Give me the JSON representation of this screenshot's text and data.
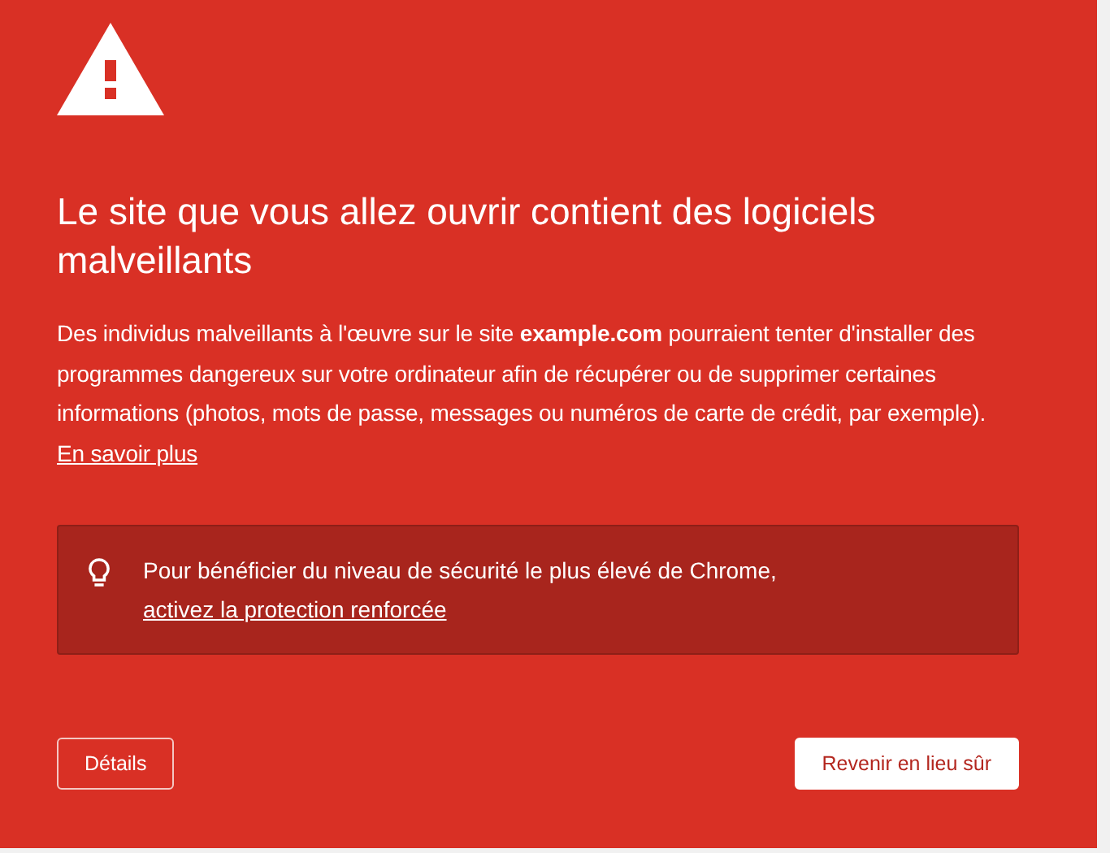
{
  "heading": "Le site que vous allez ouvrir contient des logiciels malveillants",
  "body": {
    "text": "Des individus malveillants à l'œuvre sur le site **example.com** pourraient tenter d'installer des programmes dangereux sur votre ordinateur afin de récupérer ou de supprimer certaines informations (photos, mots de passe, messages ou numéros de carte de crédit, par exemple).",
    "link": "En savoir plus"
  },
  "callout": {
    "text": "Pour bénéficier du niveau de sécurité le plus élevé de Chrome,",
    "link": "activez la protection renforcée"
  },
  "buttons": [
    {
      "label": "Détails",
      "kind": "outline"
    },
    {
      "label": "Revenir en lieu sûr",
      "kind": "primary"
    }
  ]
}
